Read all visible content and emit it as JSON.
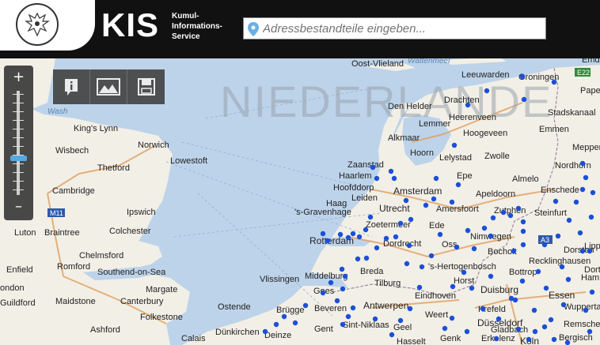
{
  "header": {
    "title": "KIS",
    "subtitle_line1": "Kumul-",
    "subtitle_line2": "Informations-",
    "subtitle_line3": "Service",
    "search_placeholder": "Adressbestandteile eingeben..."
  },
  "zoom": {
    "in_label": "+",
    "out_label": "–",
    "level_fraction": 0.68
  },
  "toolbar": {
    "info_icon": "info-icon",
    "image_icon": "image-icon",
    "save_icon": "save-icon"
  },
  "map": {
    "country_label": "NIEDERLANDE",
    "water_labels": [
      "Wash",
      "Wattenmeer"
    ],
    "road_shields": [
      "M11",
      "E22",
      "A3"
    ],
    "places": [
      "King's Lynn",
      "Norwich",
      "Wisbech",
      "Thetford",
      "Lowestoft",
      "Cambridge",
      "Ipswich",
      "Luton",
      "Braintree",
      "Colchester",
      "Chelmsford",
      "Southend-on-Sea",
      "Enfield",
      "Romford",
      "ondon",
      "Margate",
      "Maidstone",
      "Canterbury",
      "Guildford",
      "Folkestone",
      "Ashford",
      "Calais",
      "Oost-Vlieland",
      "Leeuwarden",
      "Groningen",
      "Drachten",
      "Heerenveen",
      "Den Helder",
      "Lemmer",
      "Hoogeveen",
      "Emmen",
      "Stadskanaal",
      "Alkmaar",
      "Hoorn",
      "Lelystad",
      "Zwolle",
      "Zaanstad",
      "Haarlem",
      "Hoofddorp",
      "Amsterdam",
      "Leiden",
      "Apeldoorn",
      "Enschede",
      "Almelo",
      "Nordhorn",
      "Haag",
      "'s-Gravenhage",
      "Utrecht",
      "Amersfoort",
      "Zutphen",
      "Steinfurt",
      "Zoetermeer",
      "Ede",
      "Rotterdam",
      "Dordrecht",
      "Oss",
      "Nimwegen",
      "Bocholt",
      "Vlissingen",
      "Middelburg",
      "Breda",
      "'s-Hertogenbosch",
      "Tilburg",
      "Horst",
      "Goes",
      "Eindhoven",
      "Duisburg",
      "Essen",
      "Recklinghausen",
      "Bottrop",
      "Ostende",
      "Brügge",
      "Beveren",
      "Antwerpen",
      "Krefeld",
      "Wuppertal",
      "Düsseldorf",
      "Remscheid",
      "Dünkirchen",
      "Deinze",
      "Gent",
      "Sint-Niklaas",
      "Geel",
      "Weert",
      "Hasselt",
      "Genk",
      "Erkelenz",
      "Köln",
      "Bergisch",
      "Emden",
      "Papenburg",
      "Meppen",
      "Epe",
      "Dorsten",
      "Hamm",
      "Lippst",
      "Dortm",
      "Gladbach"
    ]
  }
}
